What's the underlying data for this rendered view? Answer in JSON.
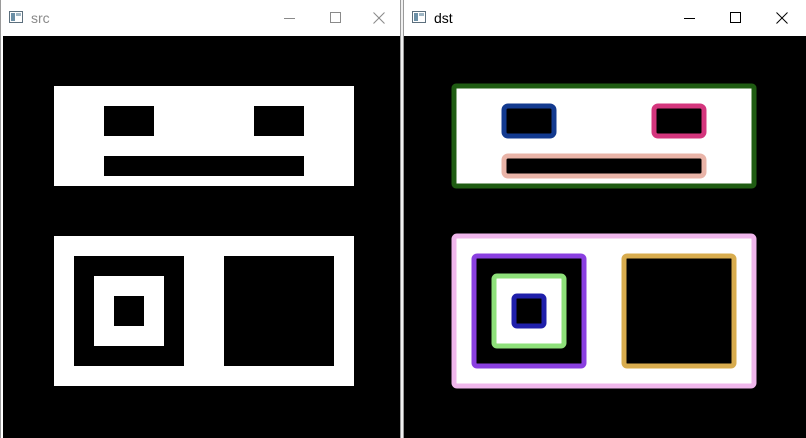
{
  "windows": {
    "src": {
      "title": "src",
      "controls": {
        "minimize_icon": "minimize-icon",
        "maximize_icon": "maximize-icon",
        "close_icon": "close-icon"
      },
      "image": {
        "background": "#000000",
        "foreground": "#ffffff"
      }
    },
    "dst": {
      "title": "dst",
      "controls": {
        "minimize_icon": "minimize-icon",
        "maximize_icon": "maximize-icon",
        "close_icon": "close-icon"
      },
      "image": {
        "background": "#000000",
        "foreground": "#ffffff",
        "contour_colors": {
          "outer_top_rectangle": "#1f5c12",
          "left_eye": "#133a8f",
          "right_eye": "#d4367d",
          "mouth": "#e9b4a8",
          "outer_bottom_rectangle": "#f0b7ec",
          "left_square_outer": "#8a3fe0",
          "left_square_middle": "#8ee07a",
          "left_square_inner": "#1f1faa",
          "right_square": "#d8ac4e"
        }
      }
    }
  }
}
